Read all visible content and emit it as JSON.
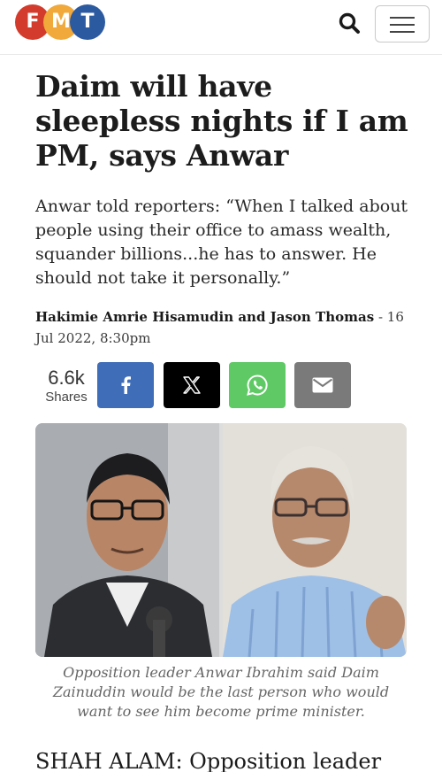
{
  "header": {
    "logo": {
      "letters": [
        "F",
        "M",
        "T"
      ],
      "colors": [
        "#d33b2c",
        "#f0a93a",
        "#2c5aa0"
      ]
    },
    "search_icon": "search-icon",
    "menu_icon": "hamburger-menu-icon"
  },
  "article": {
    "headline": "Daim will have sleepless nights if I am PM, says Anwar",
    "lede": "Anwar told reporters: “When I talked about people using their office to amass wealth, squander billions...he has to answer. He should not take it personally.”",
    "authors": "Hakimie Amrie Hisamudin and Jason Thomas",
    "date_sep": " - ",
    "date": "16 Jul 2022, 8:30pm",
    "caption": "Opposition leader Anwar Ibrahim said Daim Zainuddin would be the last person who would want to see him become prime minister.",
    "body_start": "SHAH ALAM: Opposition leader"
  },
  "share": {
    "count": "6.6k",
    "label": "Shares",
    "buttons": [
      {
        "name": "facebook",
        "icon": "facebook-icon",
        "color": "#3f6db7"
      },
      {
        "name": "x",
        "icon": "x-icon",
        "color": "#000000"
      },
      {
        "name": "whatsapp",
        "icon": "whatsapp-icon",
        "color": "#5fc965"
      },
      {
        "name": "email",
        "icon": "email-icon",
        "color": "#7a7a7a"
      }
    ]
  }
}
